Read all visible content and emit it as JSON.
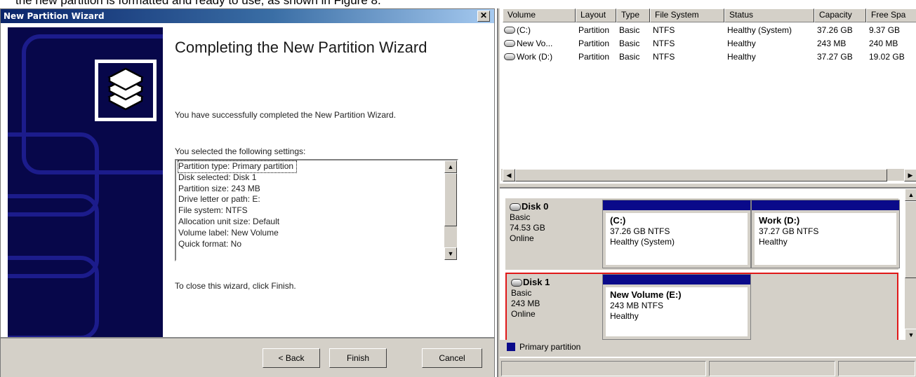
{
  "caption_fragment": "the new partition is formatted and ready to use, as shown in Figure 8.",
  "wizard": {
    "title": "New Partition Wizard",
    "close_glyph": "✕",
    "heading": "Completing the New Partition Wizard",
    "success_text": "You have successfully completed the New Partition Wizard.",
    "settings_label": "You selected the following settings:",
    "settings": [
      "Partition type: Primary partition",
      "Disk selected: Disk 1",
      "Partition size: 243 MB",
      "Drive letter or path: E:",
      "File system: NTFS",
      "Allocation unit size: Default",
      "Volume label: New Volume",
      "Quick format: No"
    ],
    "close_instruction": "To close this wizard, click Finish.",
    "buttons": {
      "back": "< Back",
      "finish": "Finish",
      "cancel": "Cancel"
    }
  },
  "volume_list": {
    "columns": [
      "Volume",
      "Layout",
      "Type",
      "File System",
      "Status",
      "Capacity",
      "Free Spa"
    ],
    "rows": [
      [
        "(C:)",
        "Partition",
        "Basic",
        "NTFS",
        "Healthy (System)",
        "37.26 GB",
        "9.37 GB"
      ],
      [
        "New Vo...",
        "Partition",
        "Basic",
        "NTFS",
        "Healthy",
        "243 MB",
        "240 MB"
      ],
      [
        "Work (D:)",
        "Partition",
        "Basic",
        "NTFS",
        "Healthy",
        "37.27 GB",
        "19.02 GB"
      ]
    ]
  },
  "disks": [
    {
      "name": "Disk 0",
      "type": "Basic",
      "size": "74.53 GB",
      "state": "Online",
      "partitions": [
        {
          "name": "(C:)",
          "detail": "37.26 GB NTFS",
          "status": "Healthy (System)"
        },
        {
          "name": "Work  (D:)",
          "detail": "37.27 GB NTFS",
          "status": "Healthy"
        }
      ]
    },
    {
      "name": "Disk 1",
      "type": "Basic",
      "size": "243 MB",
      "state": "Online",
      "partitions": [
        {
          "name": "New Volume  (E:)",
          "detail": "243 MB NTFS",
          "status": "Healthy"
        }
      ]
    }
  ],
  "legend": {
    "label": "Primary partition",
    "color": "#0a0a8a"
  },
  "colors": {
    "selection_outline": "#e01818",
    "wizard_side": "#07074a"
  }
}
